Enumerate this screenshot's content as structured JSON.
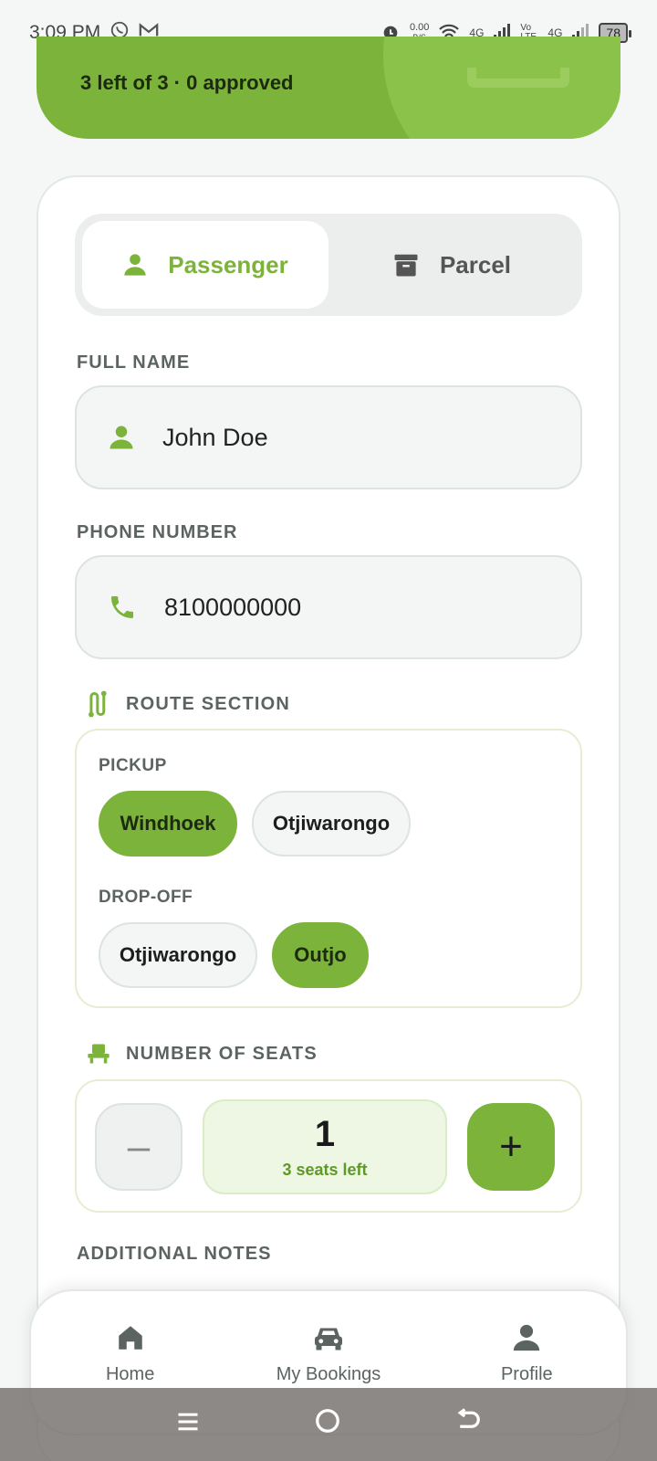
{
  "status_bar": {
    "time": "3:09 PM",
    "net_speed_value": "0.00",
    "net_speed_unit": "B/S",
    "net1": "4G",
    "volte": "Vo LTE",
    "net2": "4G",
    "battery": "78"
  },
  "hero": {
    "summary": "3 left of 3 · 0 approved"
  },
  "segment": {
    "passenger": "Passenger",
    "parcel": "Parcel",
    "active": "passenger"
  },
  "form": {
    "full_name_label": "FULL NAME",
    "full_name_value": "John Doe",
    "phone_label": "PHONE NUMBER",
    "phone_value": "8100000000",
    "route_title": "ROUTE SECTION",
    "pickup_label": "PICKUP",
    "pickup_options": [
      "Windhoek",
      "Otjiwarongo"
    ],
    "pickup_selected": "Windhoek",
    "dropoff_label": "DROP-OFF",
    "dropoff_options": [
      "Otjiwarongo",
      "Outjo"
    ],
    "dropoff_selected": "Outjo",
    "seats_title": "NUMBER OF SEATS",
    "seats_count": "1",
    "seats_left": "3 seats left",
    "minus": "–",
    "plus": "+",
    "notes_label": "ADDITIONAL NOTES"
  },
  "bottom_nav": {
    "home": "Home",
    "bookings": "My Bookings",
    "profile": "Profile"
  },
  "colors": {
    "accent": "#7cb33a",
    "accent_light": "#eef6e4"
  }
}
